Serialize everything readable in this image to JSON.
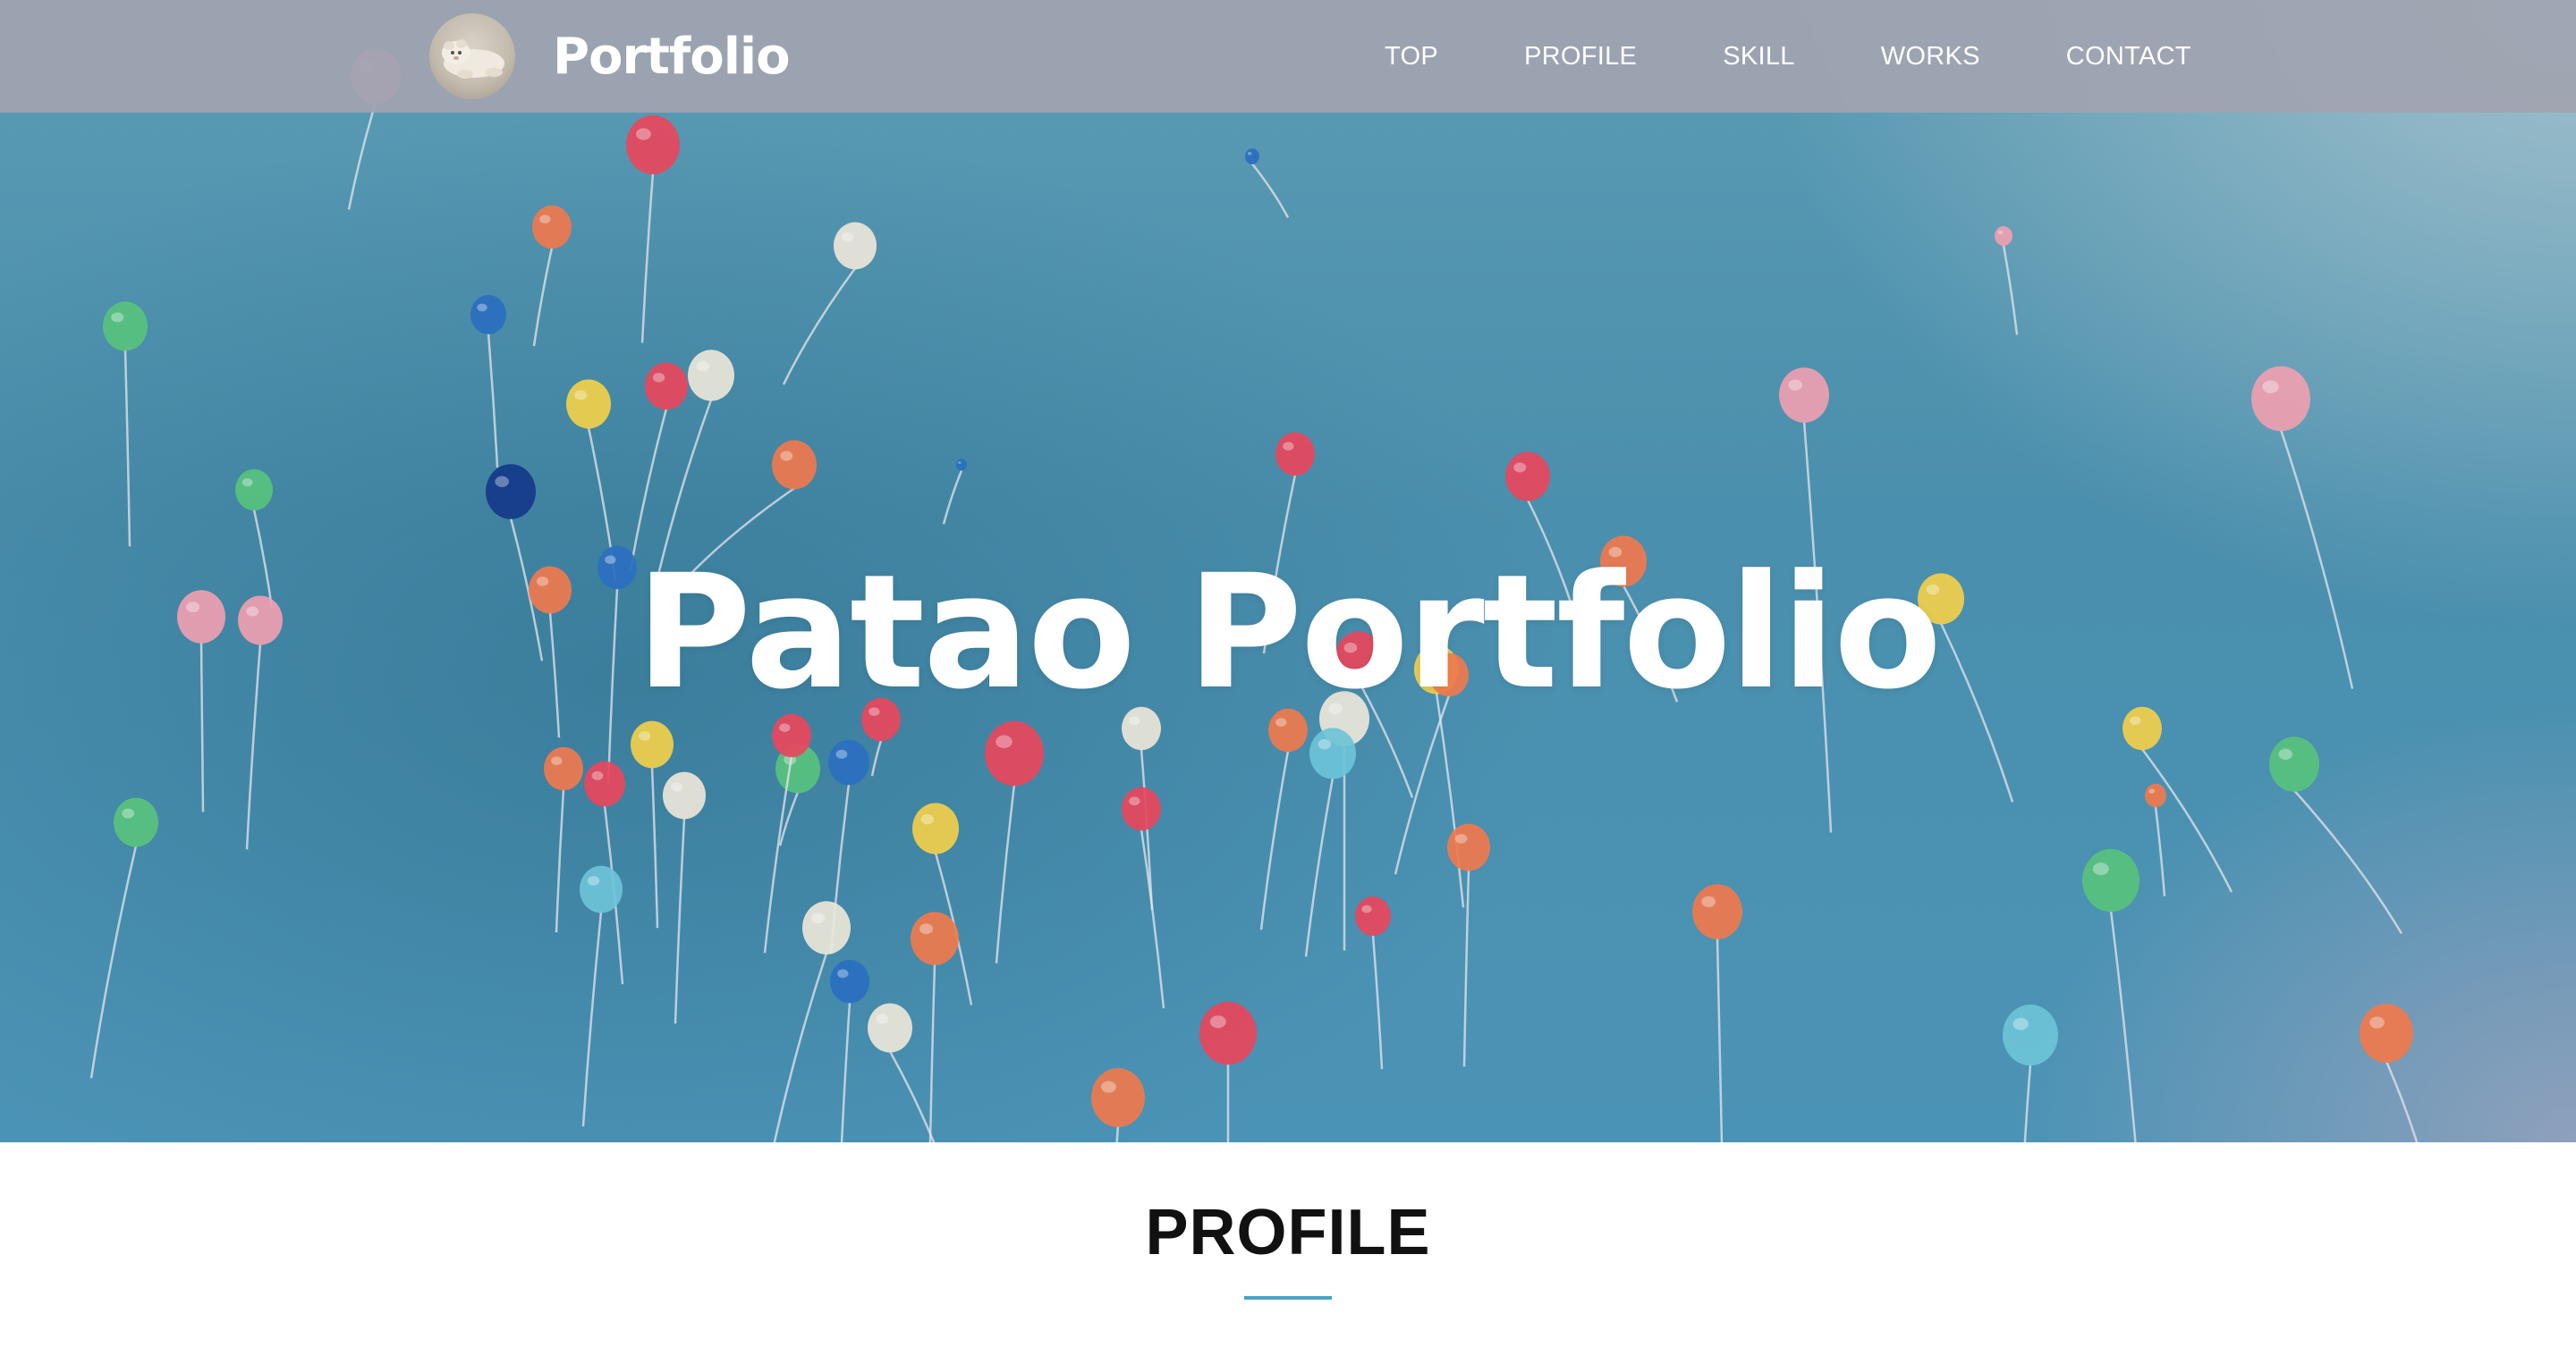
{
  "header": {
    "site_title": "Portfolio",
    "nav": [
      "TOP",
      "PROFILE",
      "SKILL",
      "WORKS",
      "CONTACT"
    ]
  },
  "hero": {
    "title": "Patao Portfolio"
  },
  "profile": {
    "heading": "PROFILE"
  },
  "colors": {
    "header_bg": "#a0a4b0",
    "hero_blue": "#4a8fad",
    "accent_underline": "#4aa3c6",
    "text_white": "#ffffff",
    "text_dark": "#111111"
  }
}
